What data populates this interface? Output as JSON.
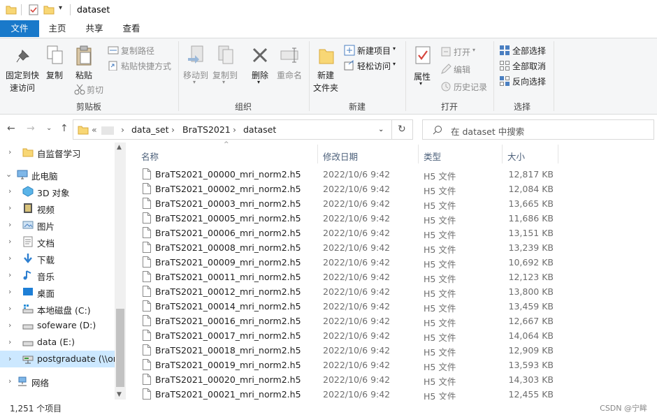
{
  "window": {
    "title": "dataset"
  },
  "tabs": [
    "文件",
    "主页",
    "共享",
    "查看"
  ],
  "ribbon": {
    "clipboard": {
      "pin": "固定到快速访问",
      "pin1": "固定到快",
      "pin2": "速访问",
      "copy": "复制",
      "paste": "粘贴",
      "copy_path": "复制路径",
      "paste_shortcut": "粘贴快捷方式",
      "cut": "剪切",
      "label": "剪贴板"
    },
    "organize": {
      "move_to": "移动到",
      "copy_to": "复制到",
      "delete": "删除",
      "rename": "重命名",
      "label": "组织"
    },
    "new": {
      "new_folder1": "新建",
      "new_folder2": "文件夹",
      "new_item": "新建项目",
      "easy_access": "轻松访问",
      "label": "新建"
    },
    "open": {
      "properties": "属性",
      "open": "打开",
      "edit": "编辑",
      "history": "历史记录",
      "label": "打开"
    },
    "select": {
      "select_all": "全部选择",
      "select_none": "全部取消",
      "invert": "反向选择",
      "label": "选择"
    }
  },
  "address": {
    "prefix": "«",
    "crumbs": [
      "data_set",
      "BraTS2021",
      "dataset"
    ]
  },
  "search": {
    "placeholder": "在 dataset 中搜索"
  },
  "nav": {
    "quick": "自监督学习",
    "pc": "此电脑",
    "items": [
      "3D 对象",
      "视频",
      "图片",
      "文档",
      "下载",
      "音乐",
      "桌面",
      "本地磁盘 (C:)",
      "sofeware (D:)",
      "data (E:)",
      "postgraduate (\\\\or"
    ],
    "network": "网络"
  },
  "columns": {
    "name": "名称",
    "date": "修改日期",
    "type": "类型",
    "size": "大小"
  },
  "files": [
    {
      "name": "BraTS2021_00000_mri_norm2.h5",
      "date": "2022/10/6 9:42",
      "type": "H5 文件",
      "size": "12,817 KB"
    },
    {
      "name": "BraTS2021_00002_mri_norm2.h5",
      "date": "2022/10/6 9:42",
      "type": "H5 文件",
      "size": "12,084 KB"
    },
    {
      "name": "BraTS2021_00003_mri_norm2.h5",
      "date": "2022/10/6 9:42",
      "type": "H5 文件",
      "size": "13,665 KB"
    },
    {
      "name": "BraTS2021_00005_mri_norm2.h5",
      "date": "2022/10/6 9:42",
      "type": "H5 文件",
      "size": "11,686 KB"
    },
    {
      "name": "BraTS2021_00006_mri_norm2.h5",
      "date": "2022/10/6 9:42",
      "type": "H5 文件",
      "size": "13,151 KB"
    },
    {
      "name": "BraTS2021_00008_mri_norm2.h5",
      "date": "2022/10/6 9:42",
      "type": "H5 文件",
      "size": "13,239 KB"
    },
    {
      "name": "BraTS2021_00009_mri_norm2.h5",
      "date": "2022/10/6 9:42",
      "type": "H5 文件",
      "size": "10,692 KB"
    },
    {
      "name": "BraTS2021_00011_mri_norm2.h5",
      "date": "2022/10/6 9:42",
      "type": "H5 文件",
      "size": "12,123 KB"
    },
    {
      "name": "BraTS2021_00012_mri_norm2.h5",
      "date": "2022/10/6 9:42",
      "type": "H5 文件",
      "size": "13,800 KB"
    },
    {
      "name": "BraTS2021_00014_mri_norm2.h5",
      "date": "2022/10/6 9:42",
      "type": "H5 文件",
      "size": "13,459 KB"
    },
    {
      "name": "BraTS2021_00016_mri_norm2.h5",
      "date": "2022/10/6 9:42",
      "type": "H5 文件",
      "size": "12,667 KB"
    },
    {
      "name": "BraTS2021_00017_mri_norm2.h5",
      "date": "2022/10/6 9:42",
      "type": "H5 文件",
      "size": "14,064 KB"
    },
    {
      "name": "BraTS2021_00018_mri_norm2.h5",
      "date": "2022/10/6 9:42",
      "type": "H5 文件",
      "size": "12,909 KB"
    },
    {
      "name": "BraTS2021_00019_mri_norm2.h5",
      "date": "2022/10/6 9:42",
      "type": "H5 文件",
      "size": "13,593 KB"
    },
    {
      "name": "BraTS2021_00020_mri_norm2.h5",
      "date": "2022/10/6 9:42",
      "type": "H5 文件",
      "size": "14,303 KB"
    },
    {
      "name": "BraTS2021_00021_mri_norm2.h5",
      "date": "2022/10/6 9:42",
      "type": "H5 文件",
      "size": "12,455 KB"
    }
  ],
  "status": {
    "count": "1,251 个项目",
    "watermark": "CSDN @宁眸"
  }
}
